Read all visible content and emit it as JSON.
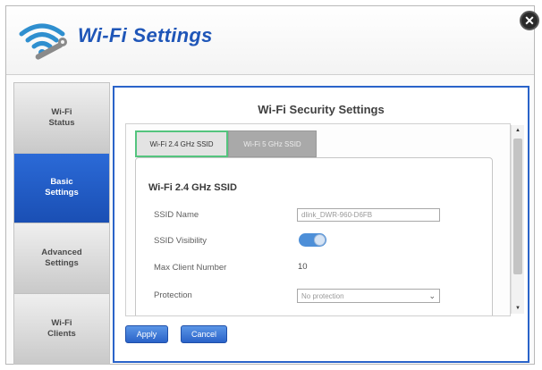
{
  "header": {
    "title": "Wi-Fi Settings",
    "logo_icon": "wifi-wrench-icon",
    "close_icon": "close-icon",
    "close_glyph": "✕"
  },
  "sidebar": {
    "items": [
      {
        "line1": "Wi-Fi",
        "line2": "Status",
        "active": false
      },
      {
        "line1": "Basic",
        "line2": "Settings",
        "active": true
      },
      {
        "line1": "Advanced",
        "line2": "Settings",
        "active": false
      },
      {
        "line1": "Wi-Fi",
        "line2": "Clients",
        "active": false
      }
    ]
  },
  "main": {
    "title": "Wi-Fi Security Settings",
    "tabs": [
      {
        "label": "Wi-Fi 2.4 GHz SSID",
        "selected": true
      },
      {
        "label": "Wi-Fi 5 GHz SSID",
        "selected": false
      }
    ],
    "section_heading": "Wi-Fi 2.4 GHz SSID",
    "fields": {
      "ssid_name_label": "SSID Name",
      "ssid_name_value": "dlink_DWR-960-D6FB",
      "ssid_visibility_label": "SSID Visibility",
      "ssid_visibility_on": true,
      "max_client_label": "Max Client Number",
      "max_client_value": "10",
      "protection_label": "Protection",
      "protection_value": "No protection"
    }
  },
  "buttons": {
    "apply": "Apply",
    "cancel": "Cancel"
  },
  "colors": {
    "accent": "#2a63c9",
    "title": "#1f56b8",
    "active_tab_border": "#54c47e"
  }
}
